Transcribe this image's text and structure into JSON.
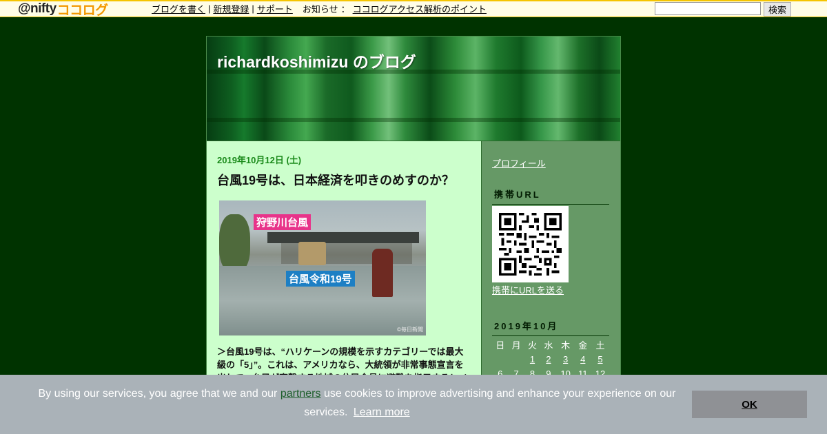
{
  "topbar": {
    "logo_at": "@nifty",
    "logo_coco": "ココログ",
    "links": [
      "ブログを書く",
      "新規登録",
      "サポート"
    ],
    "notice_label": "お知らせ",
    "notice_link": "ココログアクセス解析のポイント",
    "search_button": "検索",
    "search_value": ""
  },
  "blog": {
    "title": "richardkoshimizu のブログ"
  },
  "post": {
    "date": "2019年10月12日 (土)",
    "title": "台風19号は、日本経済を叩きのめすのか？",
    "photo_tag1": "狩野川台風",
    "photo_tag2": "台風令和19号",
    "photo_credit": "©毎日新聞",
    "excerpt": "＞台風19号は、“ハリケーンの規模を示すカテゴリーでは最大級の「5」”。これは、アメリカなら、大統領が非常事態宣言を出して、台風が直撃する地域の住民全員に避難を指示するレベ"
  },
  "sidebar": {
    "profile_link": "プロフィール",
    "mobile_heading": "携帯URL",
    "send_url_link": "携帯にURLを送る",
    "calendar_heading": "2019年10月",
    "weekdays": [
      "日",
      "月",
      "火",
      "水",
      "木",
      "金",
      "土"
    ],
    "week1": [
      "",
      "",
      "1",
      "2",
      "3",
      "4",
      "5"
    ],
    "week2": [
      "6",
      "7",
      "8",
      "9",
      "10",
      "11",
      "12"
    ]
  },
  "cookie": {
    "text_before": "By using our services, you agree that we and our",
    "partners_link": "partners",
    "text_after": "use cookies to improve advertising and enhance your experience on our services.",
    "learn_more": "Learn more",
    "ok_button": "OK"
  },
  "colors": {
    "page_bg": "#003300",
    "content_bg": "#ccffcc",
    "sidebar_bg": "#669966",
    "date_green": "#1a8a1a",
    "logo_orange": "#f39800"
  }
}
